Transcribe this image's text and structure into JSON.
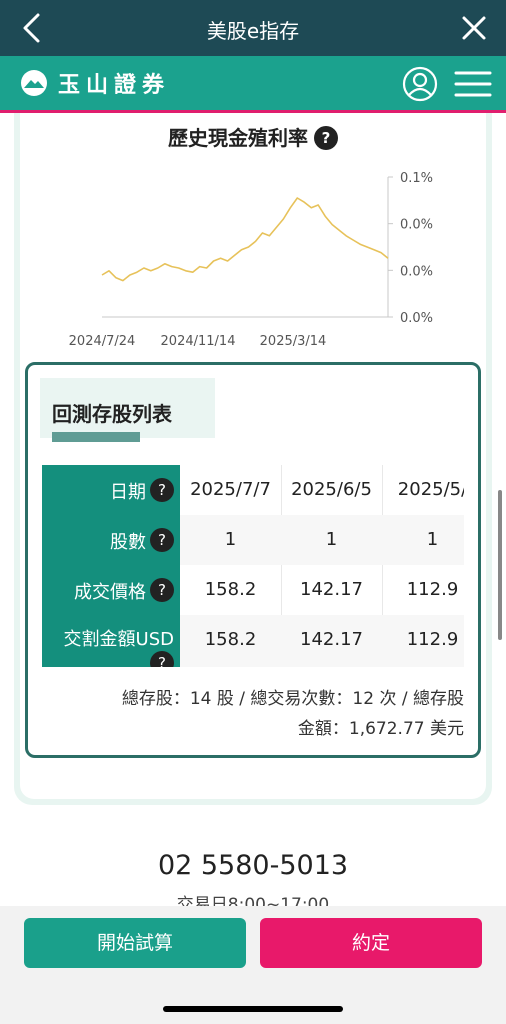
{
  "header": {
    "title": "美股e指存"
  },
  "brand": {
    "name": "玉山證券"
  },
  "chart_section": {
    "title": "歷史現金殖利率",
    "help": "?"
  },
  "chart_data": {
    "type": "line",
    "title": "歷史現金殖利率",
    "x_ticks": [
      "2024/7/24",
      "2024/11/14",
      "2025/3/14"
    ],
    "y_ticks": [
      "0.1%",
      "0.0%",
      "0.0%",
      "0.0%"
    ],
    "series": [
      {
        "values": [
          0.5,
          0.53,
          0.48,
          0.46,
          0.5,
          0.52,
          0.55,
          0.53,
          0.55,
          0.58,
          0.56,
          0.55,
          0.53,
          0.52,
          0.56,
          0.55,
          0.6,
          0.62,
          0.6,
          0.64,
          0.68,
          0.7,
          0.74,
          0.8,
          0.78,
          0.84,
          0.9,
          0.98,
          1.05,
          1.02,
          0.98,
          1.0,
          0.92,
          0.86,
          0.82,
          0.78,
          0.75,
          0.72,
          0.7,
          0.68,
          0.66,
          0.62
        ]
      }
    ],
    "line_color": "#e7c25a",
    "grid": false
  },
  "backtest": {
    "title": "回測存股列表",
    "help": "?",
    "labels": {
      "date": "日期",
      "shares": "股數",
      "price": "成交價格",
      "amount": "交割金額USD"
    },
    "rows": [
      {
        "date": "2025/7/7",
        "shares": "1",
        "price": "158.2",
        "amount": "158.2"
      },
      {
        "date": "2025/6/5",
        "shares": "1",
        "price": "142.17",
        "amount": "142.17"
      },
      {
        "date": "2025/5/",
        "shares": "1",
        "price": "112.9",
        "amount": "112.9"
      }
    ],
    "summary_line1": "總存股：14 股 / 總交易次數：12 次 / 總存股",
    "summary_line2": "金額：1,672.77 美元"
  },
  "contact": {
    "phone": "02 5580-5013",
    "hours": "交易日8:00~17:00"
  },
  "buttons": {
    "start": "開始試算",
    "appointment": "約定"
  },
  "colors": {
    "header": "#1e4a55",
    "brand": "#1ba28e",
    "accent": "#e8196a",
    "table_head": "#148f7d"
  },
  "icons": {
    "back": "chevron-left-icon",
    "close": "close-icon",
    "account": "account-icon",
    "menu": "hamburger-menu-icon",
    "help": "question-circle-icon"
  }
}
